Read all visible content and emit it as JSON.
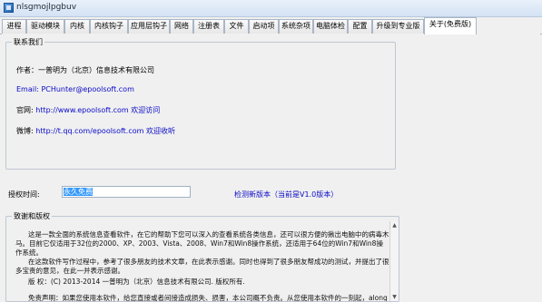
{
  "window": {
    "title": "nlsgmojlpgbuv"
  },
  "tabs": [
    {
      "id": "process",
      "label": "进程"
    },
    {
      "id": "driver",
      "label": "驱动模块"
    },
    {
      "id": "kernel",
      "label": "内核"
    },
    {
      "id": "kernel_hooks",
      "label": "内核钩子"
    },
    {
      "id": "app_hooks",
      "label": "应用层钩子"
    },
    {
      "id": "network",
      "label": "网络"
    },
    {
      "id": "registry",
      "label": "注册表"
    },
    {
      "id": "files",
      "label": "文件"
    },
    {
      "id": "startup",
      "label": "启动项"
    },
    {
      "id": "misc",
      "label": "系统杂项"
    },
    {
      "id": "checkup",
      "label": "电脑体检"
    },
    {
      "id": "config",
      "label": "配置"
    },
    {
      "id": "upgrade",
      "label": "升级到专业版"
    },
    {
      "id": "about",
      "label": "关于(免费版)",
      "active": true
    }
  ],
  "about": {
    "legend": "联系我们",
    "author": "作者：一普明为（北京）信息技术有限公司",
    "email_label": "Email: ",
    "email": "PCHunter@epoolsoft.com",
    "site_label": "官网: ",
    "site_url": "http://www.epoolsoft.com",
    "site_visit": "欢迎访问",
    "weibo_label": "微博: ",
    "weibo_url": "http://t.qq.com/epoolsoft.com",
    "weibo_follow": "欢迎收听"
  },
  "license": {
    "label": "授权时间:",
    "value": "永久免费",
    "check_update": "检测新版本（当前是V1.0版本）"
  },
  "thanks": {
    "legend": "致谢和版权",
    "p1": "这是一款全面的系统信息查看软件，在它的帮助下您可以深入的查看系统各类信息，还可以很方便的揪出电脑中的病毒木马。目前它仅适用于32位的2000、XP、2003、Vista、2008、Win7和Win8操作系统，还适用于64位的Win7和Win8操作系统。",
    "p2": "在这款软件写作过程中，参考了很多朋友的技术文章，在此表示感谢。同时也得到了很多朋友帮成功的测试，并提出了很多宝贵的意见，在此一并表示感谢。",
    "p3": "版 权：(C) 2013-2014 一普明为（北京）信息技术有限公司. 版权所有.",
    "p4": "免责声明：如果您使用本软件，给您直接或者间接造成损失、损害，本公司概不负责。从您使用本软件的一刻起，along视"
  },
  "colors": {
    "link": "#0a0ac8",
    "selection": "#3399ff"
  }
}
